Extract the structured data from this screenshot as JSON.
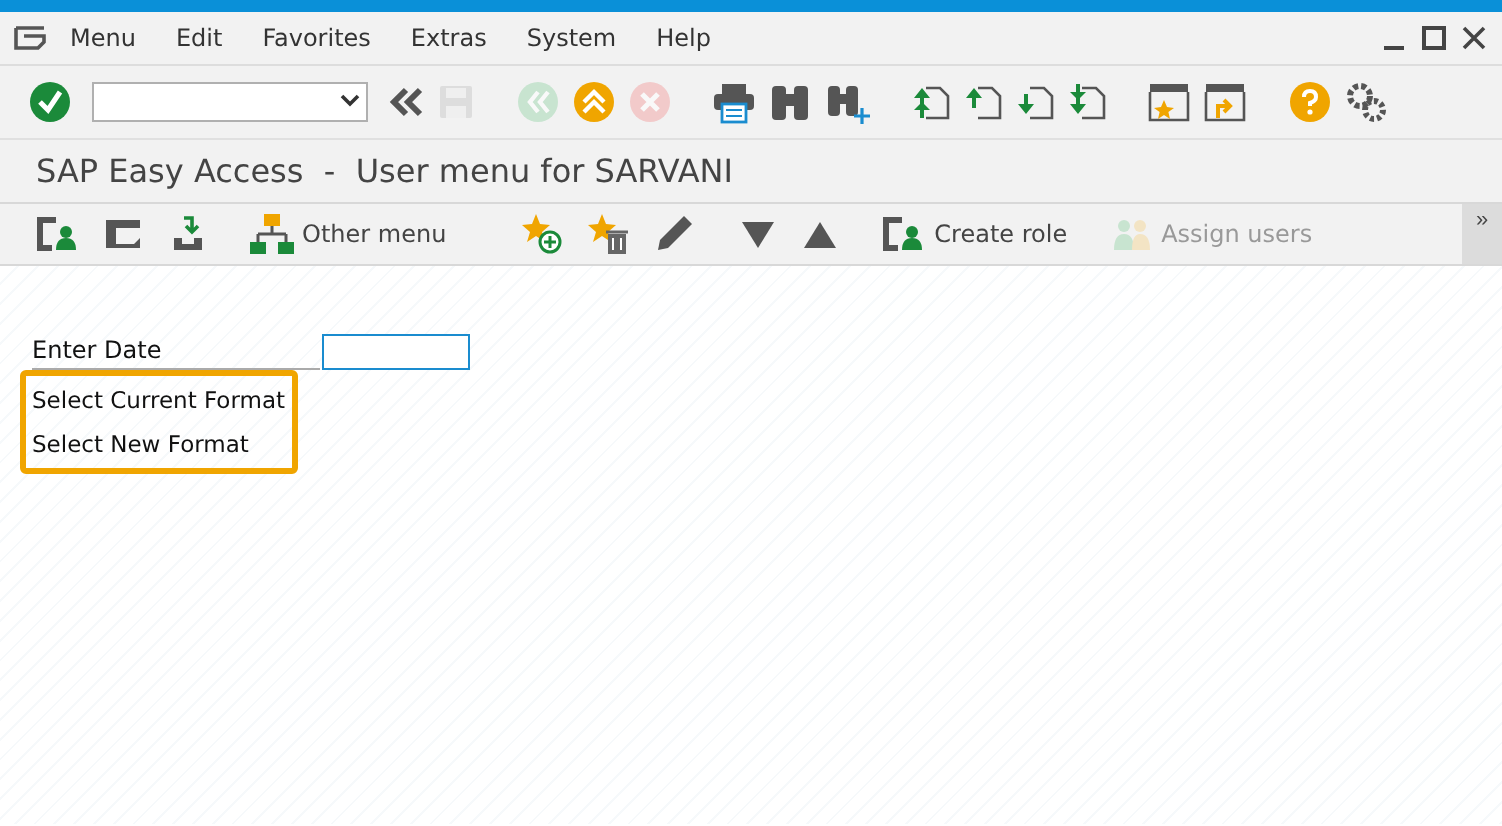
{
  "menu_bar": {
    "items": [
      {
        "label": "Menu"
      },
      {
        "label": "Edit"
      },
      {
        "label": "Favorites"
      },
      {
        "label": "Extras"
      },
      {
        "label": "System"
      },
      {
        "label": "Help"
      }
    ]
  },
  "toolbar": [
    {
      "kind": "check",
      "disabled": false
    },
    {
      "kind": "command-field"
    },
    {
      "kind": "collapse",
      "disabled": false
    },
    {
      "kind": "save",
      "disabled": true
    },
    {
      "kind": "sep"
    },
    {
      "kind": "back",
      "disabled": true
    },
    {
      "kind": "exit",
      "disabled": false
    },
    {
      "kind": "cancel",
      "disabled": true
    },
    {
      "kind": "sep"
    },
    {
      "kind": "print",
      "disabled": false
    },
    {
      "kind": "find",
      "disabled": false
    },
    {
      "kind": "find-next",
      "disabled": false
    },
    {
      "kind": "sep"
    },
    {
      "kind": "first-page",
      "disabled": false
    },
    {
      "kind": "prev-page",
      "disabled": false
    },
    {
      "kind": "next-page",
      "disabled": false
    },
    {
      "kind": "last-page",
      "disabled": false
    },
    {
      "kind": "sep"
    },
    {
      "kind": "new-session",
      "disabled": false
    },
    {
      "kind": "shortcut",
      "disabled": false
    },
    {
      "kind": "sep"
    },
    {
      "kind": "help",
      "disabled": false
    },
    {
      "kind": "settings",
      "disabled": false
    }
  ],
  "title": "SAP Easy Access  -  User menu for SARVANI",
  "app_toolbar": {
    "buttons": [
      {
        "kind": "user-menu",
        "disabled": false
      },
      {
        "kind": "sap-menu",
        "disabled": false
      },
      {
        "kind": "download",
        "disabled": false
      },
      {
        "kind": "tree",
        "label": "Other menu",
        "disabled": false
      },
      {
        "kind": "fav-add",
        "disabled": false
      },
      {
        "kind": "fav-delete",
        "disabled": false
      },
      {
        "kind": "pencil",
        "disabled": false
      },
      {
        "kind": "down",
        "disabled": false
      },
      {
        "kind": "up",
        "disabled": false
      },
      {
        "kind": "role",
        "label": "Create role",
        "disabled": false
      },
      {
        "kind": "users",
        "label": "Assign users",
        "disabled": true
      }
    ],
    "more": "»"
  },
  "form": {
    "fields": [
      {
        "label": "Enter Date"
      }
    ],
    "highlighted_lines": [
      "Select Current Format",
      "Select New Format"
    ]
  }
}
